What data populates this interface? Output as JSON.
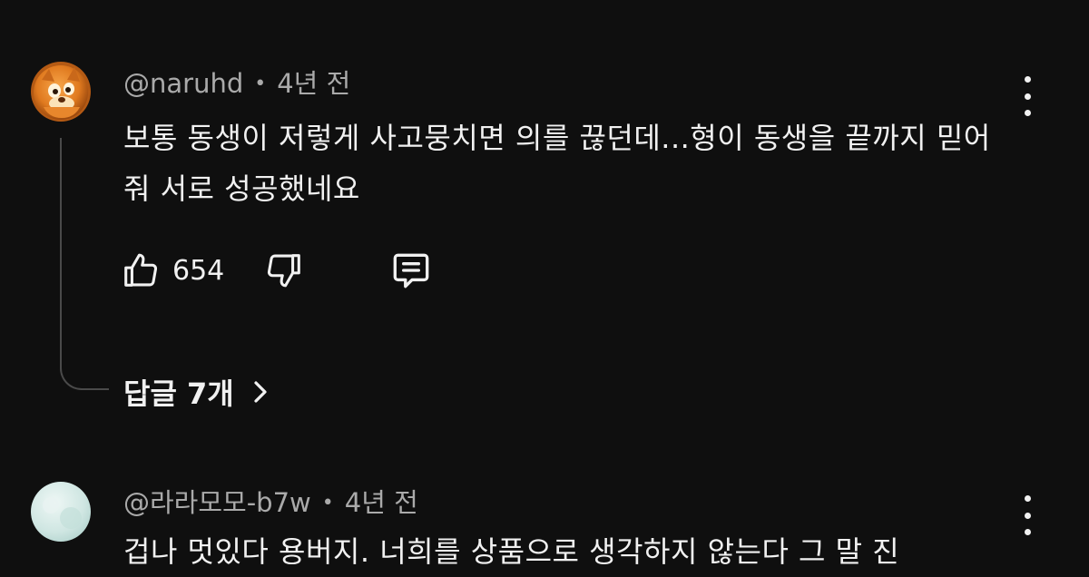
{
  "comments": [
    {
      "author": "@naruhd",
      "time": "4년 전",
      "text": "보통 동생이 저렇게 사고뭉치면 의를 끊던데...형이 동생을 끝까지 믿어줘 서로 성공했네요",
      "likes": "654",
      "replies_label": "답글 7개",
      "avatar_icon": "orange-cartoon-avatar"
    },
    {
      "author": "@라라모모-b7w",
      "time": "4년 전",
      "text": "겁나 멋있다 용버지. 너희를 상품으로 생각하지 않는다 그 말 진",
      "avatar_icon": "pale-teal-avatar"
    }
  ],
  "meta_separator": "•",
  "icons": {
    "like": "thumbs-up-icon",
    "dislike": "thumbs-down-icon",
    "reply": "comment-reply-icon",
    "more": "more-vertical-icon",
    "chevron": "chevron-right-icon"
  },
  "colors": {
    "background": "#0f0f0f",
    "primary_text": "#f1f1f1",
    "secondary_text": "#aaaaaa",
    "thread_line": "#4a4a4a"
  }
}
